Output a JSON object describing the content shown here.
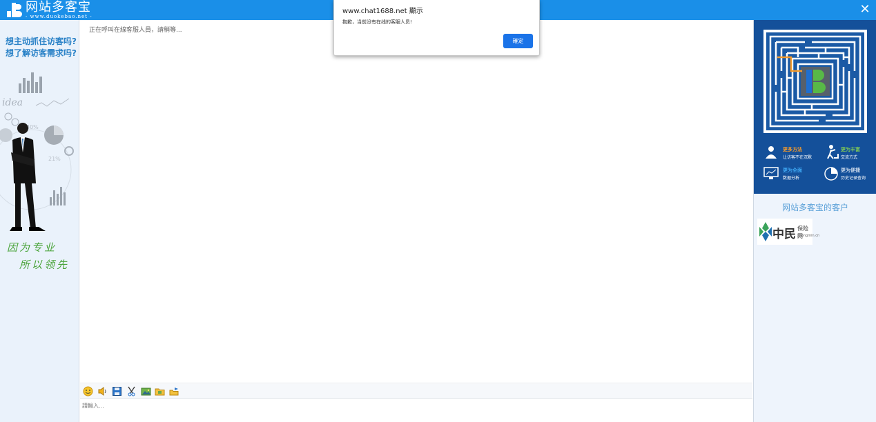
{
  "header": {
    "logo_text": "网站多客宝",
    "logo_url_text": "- www.duokebao.net -",
    "close_symbol": "✕",
    "accent_color": "#1a8fe8"
  },
  "left_promo": {
    "question_1": "想主动抓住访客吗?",
    "question_2": "想了解访客需求吗?",
    "slogan_1": "因为专业",
    "slogan_2": "所以领先"
  },
  "chat": {
    "status_text": "正在呼叫在線客服人員，請稍等...",
    "input_placeholder": "請輸入..."
  },
  "toolbar": {
    "icons": [
      "emoji-icon",
      "sound-icon",
      "save-icon",
      "screenshot-icon",
      "image-icon",
      "folder-icon",
      "file-send-icon"
    ]
  },
  "right_ad": {
    "features": [
      {
        "title": "更多方法",
        "desc": "让访客不在沉默",
        "title_color": "#f39a2c"
      },
      {
        "title": "更为丰富",
        "desc": "交流方式",
        "title_color": "#7ec857"
      },
      {
        "title": "更为全面",
        "desc": "数据分析",
        "title_color": "#3fa9f5"
      },
      {
        "title": "更为便捷",
        "desc": "历史记录查询",
        "title_color": "#c9d8ea"
      }
    ],
    "clients_title": "网站多客宝的客户",
    "client_logo_text": "中民",
    "client_logo_sub": "保险网",
    "client_logo_domain": "zhongmin.cn"
  },
  "alert": {
    "title": "www.chat1688.net 顯示",
    "message": "抱歉，当前没有在线的客服人员!",
    "ok_label": "確定"
  }
}
